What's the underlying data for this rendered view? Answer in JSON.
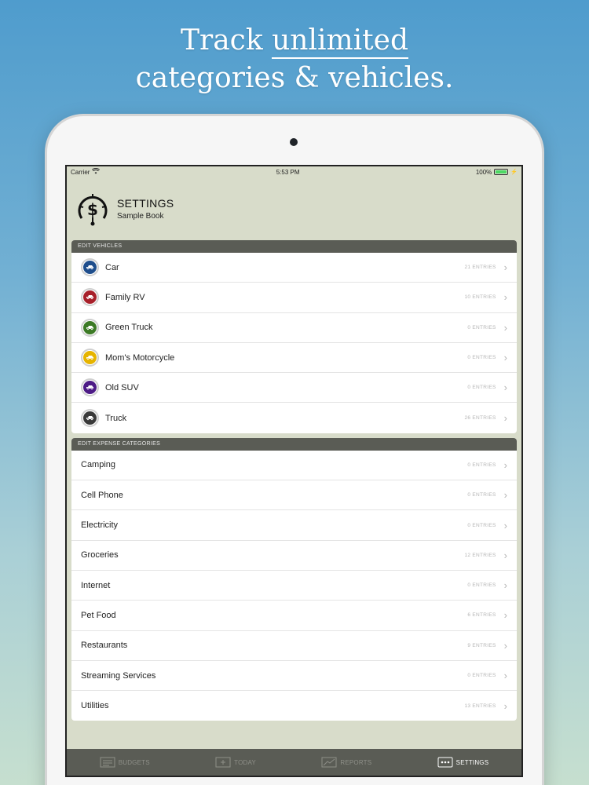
{
  "headline": {
    "line1_pre": "Track",
    "line1_underlined": "unlimited",
    "line2": "categories & vehicles."
  },
  "status_bar": {
    "carrier": "Carrier",
    "time": "5:53 PM",
    "battery": "100%"
  },
  "header": {
    "title": "SETTINGS",
    "subtitle": "Sample Book"
  },
  "vehicles": {
    "header": "EDIT VEHICLES",
    "items": [
      {
        "label": "Car",
        "entries": "21 ENTRIES",
        "color": "#1f4e8c",
        "icon": "car-icon"
      },
      {
        "label": "Family RV",
        "entries": "10 ENTRIES",
        "color": "#a8202a",
        "icon": "rv-icon"
      },
      {
        "label": "Green Truck",
        "entries": "0 ENTRIES",
        "color": "#3c7a25",
        "icon": "truck-icon"
      },
      {
        "label": "Mom's Motorcycle",
        "entries": "0 ENTRIES",
        "color": "#e6b400",
        "icon": "motorcycle-icon"
      },
      {
        "label": "Old SUV",
        "entries": "0 ENTRIES",
        "color": "#4d1b86",
        "icon": "suv-icon"
      },
      {
        "label": "Truck",
        "entries": "26 ENTRIES",
        "color": "#3a3a3a",
        "icon": "truck-icon"
      }
    ]
  },
  "categories": {
    "header": "EDIT EXPENSE CATEGORIES",
    "items": [
      {
        "label": "Camping",
        "entries": "0 ENTRIES"
      },
      {
        "label": "Cell Phone",
        "entries": "0 ENTRIES"
      },
      {
        "label": "Electricity",
        "entries": "0 ENTRIES"
      },
      {
        "label": "Groceries",
        "entries": "12 ENTRIES"
      },
      {
        "label": "Internet",
        "entries": "0 ENTRIES"
      },
      {
        "label": "Pet Food",
        "entries": "6 ENTRIES"
      },
      {
        "label": "Restaurants",
        "entries": "9 ENTRIES"
      },
      {
        "label": "Streaming Services",
        "entries": "0 ENTRIES"
      },
      {
        "label": "Utilities",
        "entries": "13 ENTRIES"
      }
    ]
  },
  "tabs": [
    {
      "label": "BUDGETS",
      "icon": "budgets-icon",
      "active": false
    },
    {
      "label": "TODAY",
      "icon": "today-icon",
      "active": false
    },
    {
      "label": "REPORTS",
      "icon": "reports-icon",
      "active": false
    },
    {
      "label": "SETTINGS",
      "icon": "settings-icon",
      "active": true
    }
  ],
  "colors": {
    "tab_bar": "#5a5c55",
    "screen_bg": "#d8dcca",
    "active_tab": "#ffffff"
  }
}
